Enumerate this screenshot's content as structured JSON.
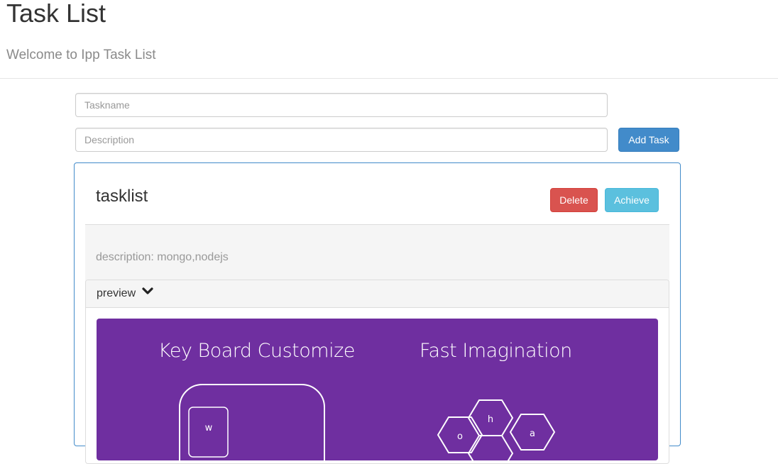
{
  "header": {
    "title": "Task List",
    "subtitle": "Welcome to Ipp Task List"
  },
  "form": {
    "taskname_placeholder": "Taskname",
    "taskname_value": "",
    "description_placeholder": "Description",
    "description_value": "",
    "add_button": "Add Task"
  },
  "task": {
    "name": "tasklist",
    "delete_label": "Delete",
    "achieve_label": "Achieve",
    "description": "description: mongo,nodejs",
    "preview_label": "preview",
    "preview_icon": "chevron-down-icon",
    "preview_image": {
      "background": "#6f2fa0",
      "left_heading": "Key Board Customize",
      "right_heading": "Fast Imagination",
      "key_letter": "w",
      "hex_letters": [
        "h",
        "o",
        "a"
      ]
    }
  },
  "colors": {
    "primary": "#428bca",
    "danger": "#d9534f",
    "info": "#5bc0de",
    "purple": "#6f2fa0"
  }
}
